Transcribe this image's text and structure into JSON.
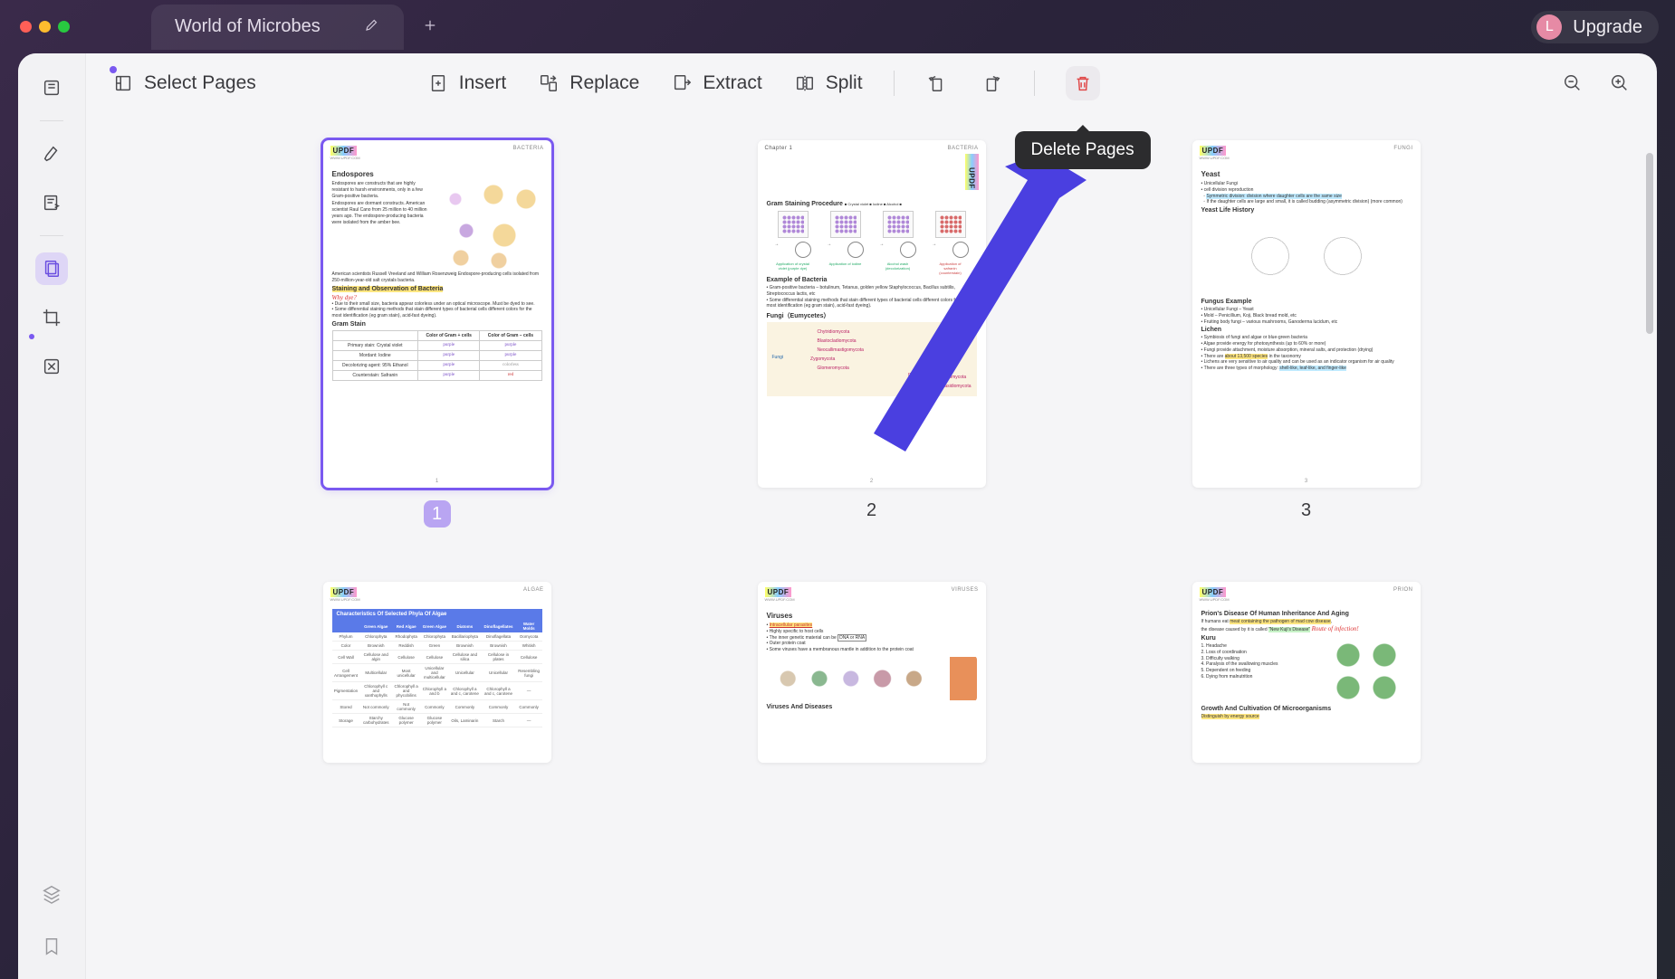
{
  "window": {
    "tab_title": "World of Microbes",
    "avatar_initial": "L",
    "upgrade_label": "Upgrade"
  },
  "toolbar": {
    "select_pages": "Select Pages",
    "insert": "Insert",
    "replace": "Replace",
    "extract": "Extract",
    "split": "Split",
    "delete_tooltip": "Delete Pages"
  },
  "pages": {
    "p1": {
      "num": "1",
      "category": "BACTERIA",
      "h_endospores": "Endospores",
      "endo_txt1": "Endospores are constructs that are highly resistant to harsh environments, only in a few Gram-positive bacteria.",
      "endo_txt2": "Endospores are dormant constructs. American scientist Raul Cano from 25 million to 40 million years ago. The endospore-producing bacteria were isolated from the amber bee.",
      "endo_txt3": "American scientists Russell Vreeland and William Rosenzweig Endospore-producing cells isolated from 250-million-year-old salt crystals bacteria.",
      "h_stain": "Staining and Observation of Bacteria",
      "why_dye": "Why dye?",
      "dye1": "Due to their small size, bacteria appear colorless under an optical microscope. Must be dyed to see.",
      "dye2": "Some differential staining methods that stain different types of bacterial cells different colors for the most identification (eg gram stain), acid-fast dyeing).",
      "h_gram": "Gram Stain",
      "tbl_h1": "Color of Gram + cells",
      "tbl_h2": "Color of Gram – cells",
      "r1": "Primary stain: Crystal violet",
      "r1a": "purple",
      "r1b": "purple",
      "r2": "Mordant: Iodine",
      "r2a": "purple",
      "r2b": "purple",
      "r3": "Decolorizing agent: 95% Ethanol",
      "r3a": "purple",
      "r3b": "colorless",
      "r4": "Counterstain: Safranin",
      "r4a": "purple",
      "r4b": "red"
    },
    "p2": {
      "num": "2",
      "chapter": "Chapter 1",
      "category": "BACTERIA",
      "h_proc": "Gram Staining Procedure",
      "legend": "■ Crystal violet  ■ Iodine  ■ Alcohol  ■",
      "s1": "Application of crystal violet (purple dye)",
      "s2": "Application of iodine",
      "s3": "Alcohol wash (decolorization)",
      "s4": "Application of safranin (counterstain)",
      "h_ex": "Example of Bacteria",
      "ex1": "Gram-positive bacteria – botulinum, Tetanus, golden yellow Staphylococcus, Bacillus subtilis, Streptococcus lactis, etc",
      "ex2": "Some differential staining methods that stain different types of bacterial cells different colors for the most identification (eg gram stain), acid-fast dyeing).",
      "h_fungi": "Fungi（Eumycetes）",
      "f1": "Chytridiomycota",
      "f2": "Blastocladiomycota",
      "f3": "Neocallimastigomycota",
      "f4": "Zygomycota",
      "f5": "Glomeromycota",
      "f6": "Ascomycota",
      "f7": "Basidiomycota",
      "flbl": "Fungi",
      "dikarya": "Dikarya"
    },
    "p3": {
      "num": "3",
      "category": "FUNGI",
      "h_yeast": "Yeast",
      "y1": "Unicellular Fungi",
      "y2": "cell division reproduction",
      "y3": "Symmetric division: division where daughter cells are the same size",
      "y4": "If the daughter cells are large and small, it is called budding (asymmetric division) (more common)",
      "h_hist": "Yeast Life History",
      "h_fex": "Fungus Example",
      "fe1": "Unicellular Fungi – Yeast",
      "fe2": "Mold – Penicillium, Koji, Black bread mold, etc",
      "fe3": "Fruiting body fungi – various mushrooms, Ganoderma lucidum, etc",
      "h_lichen": "Lichen",
      "l1": "Symbiosis of fungi and algae or blue-green bacteria",
      "l2": "Algae provide energy for photosynthesis (up to 60% or more)",
      "l3": "Fungi provide attachment, moisture absorption, mineral salts, and protection (drying)",
      "l4a": "There are ",
      "l4b": "about 13,500 species",
      "l4c": " in the taxonomy",
      "l5": "Lichens are very sensitive to air quality and can be used as an indicator organism for air quality",
      "l6a": "There are three types of morphology: ",
      "l6b": "shell-like, leaf-like, and finger-like"
    },
    "p4": {
      "category": "ALGAE",
      "h": "Characteristics Of Selected Phyla Of Algae",
      "cols": [
        "Green Algae",
        "Red Algae",
        "Green Algae",
        "Diatoms",
        "Dinoflagellates",
        "Water Molds"
      ],
      "rows": [
        "Phylum",
        "Color",
        "Cell Wall",
        "Cell Arrangement",
        "Pigmentation",
        "Stored",
        "Storage"
      ]
    },
    "p5": {
      "category": "VIRUSES",
      "h_v": "Viruses",
      "v0": "Intracellular parasites",
      "v1": "Highly specific to host cells",
      "v2a": "The inner genetic material can be ",
      "v2b": "DNA or RNA",
      "v3": "Outer protein coat",
      "v4": "Some viruses have a membranous mantle in addition to the protein coat",
      "h_vd": "Viruses And Diseases"
    },
    "p6": {
      "category": "PRION",
      "h": "Prion's Disease Of Human Inheritance And Aging",
      "p1a": "If humans eat ",
      "p1b": "meat containing the pathogen of mad cow disease",
      "p1c": ",",
      "p2a": "the disease caused by it is called ",
      "p2b": "\"New Kuji's Disease\"",
      "route": "Route of infection!",
      "h_kuru": "Kuru",
      "k1": "1. Headache",
      "k2": "2. Loss of coordination",
      "k3": "3. Difficulty walking",
      "k4": "4. Paralysis of the swallowing muscles",
      "k5": "5. Dependent on feeding",
      "k6": "6. Dying from malnutrition",
      "h_grow": "Growth And Cultivation Of Microorganisms",
      "g1": "Distinguish by energy source"
    }
  }
}
